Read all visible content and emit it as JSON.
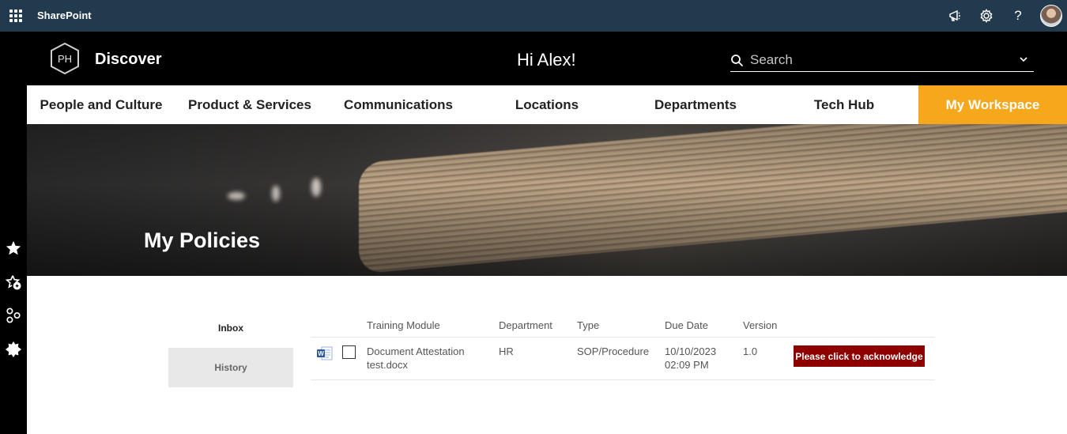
{
  "suite": {
    "app_name": "SharePoint"
  },
  "header": {
    "site_title": "Discover",
    "logo_text": "PH",
    "greeting": "Hi Alex!",
    "search_placeholder": "Search"
  },
  "nav": {
    "items": [
      {
        "label": "People and Culture"
      },
      {
        "label": "Product & Services"
      },
      {
        "label": "Communications"
      },
      {
        "label": "Locations"
      },
      {
        "label": "Departments"
      },
      {
        "label": "Tech Hub"
      },
      {
        "label": "My Workspace",
        "active": true
      }
    ]
  },
  "hero": {
    "title": "My Policies"
  },
  "tabs": {
    "inbox": "Inbox",
    "history": "History"
  },
  "table": {
    "columns": [
      "Training Module",
      "Department",
      "Type",
      "Due Date",
      "Version"
    ],
    "rows": [
      {
        "module_line1": "Document Attestation",
        "module_line2": "test.docx",
        "department": "HR",
        "type": "SOP/Procedure",
        "due_date": "10/10/2023",
        "due_time": "02:09 PM",
        "version": "1.0",
        "action": "Please click to acknowledge"
      }
    ]
  },
  "colors": {
    "suite_bar": "#223a4e",
    "accent": "#f7a71c",
    "acknowledge_button": "#8e0000"
  }
}
